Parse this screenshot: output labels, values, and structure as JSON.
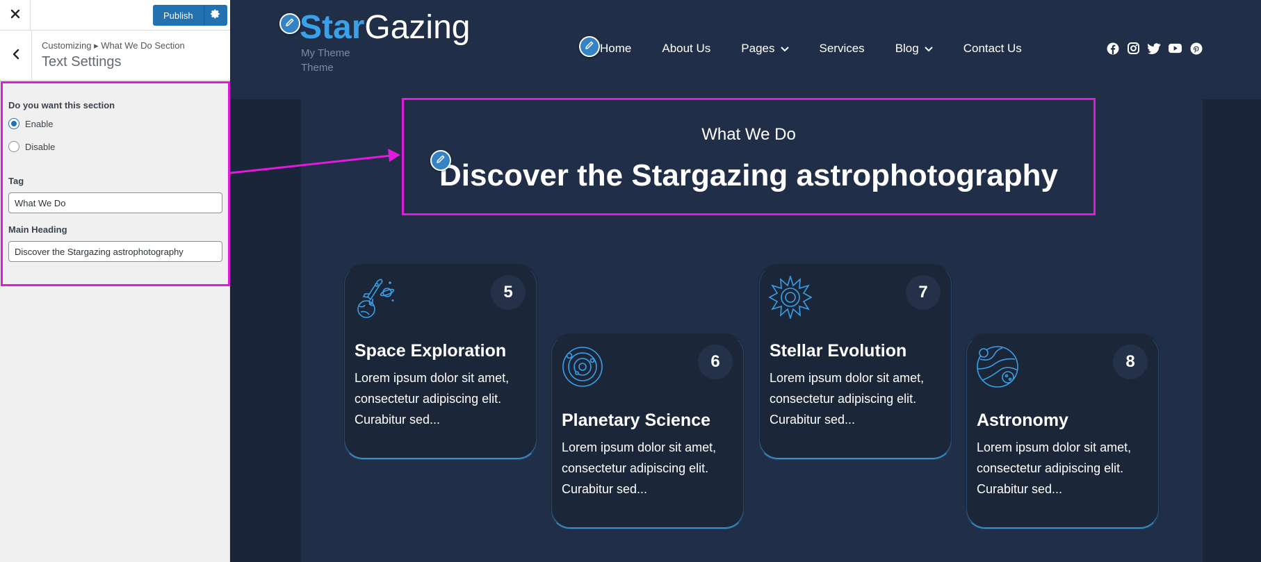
{
  "sidebar": {
    "close_icon": "close-icon",
    "publish_label": "Publish",
    "settings_icon": "gear-icon",
    "back_icon": "chevron-left-icon",
    "breadcrumb": "Customizing ▸ What We Do Section",
    "panel_title": "Text Settings",
    "section_toggle": {
      "label": "Do you want this section",
      "options": [
        "Enable",
        "Disable"
      ],
      "selected": "Enable"
    },
    "tag_field": {
      "label": "Tag",
      "value": "What We Do"
    },
    "heading_field": {
      "label": "Main Heading",
      "value": "Discover the Stargazing astrophotography"
    }
  },
  "site": {
    "logo_part1": "Star",
    "logo_part2": "Gazing",
    "tagline_line1": "My Theme",
    "tagline_line2": "Theme",
    "nav": [
      {
        "label": "Home",
        "dropdown": false
      },
      {
        "label": "About Us",
        "dropdown": false
      },
      {
        "label": "Pages",
        "dropdown": true
      },
      {
        "label": "Services",
        "dropdown": false
      },
      {
        "label": "Blog",
        "dropdown": true
      },
      {
        "label": "Contact Us",
        "dropdown": false
      }
    ],
    "social_icons": [
      "facebook-icon",
      "instagram-icon",
      "twitter-icon",
      "youtube-icon",
      "pinterest-icon"
    ]
  },
  "section": {
    "tag": "What We Do",
    "heading": "Discover the Stargazing astrophotography",
    "cards": [
      {
        "number": "5",
        "title": "Space Exploration",
        "text": "Lorem ipsum dolor sit amet, consectetur adipiscing elit. Curabitur sed...",
        "icon": "rocket-planet-icon"
      },
      {
        "number": "6",
        "title": "Planetary Science",
        "text": "Lorem ipsum dolor sit amet, consectetur adipiscing elit. Curabitur sed...",
        "icon": "orbit-icon"
      },
      {
        "number": "7",
        "title": "Stellar Evolution",
        "text": "Lorem ipsum dolor sit amet, consectetur adipiscing elit. Curabitur sed...",
        "icon": "sun-icon"
      },
      {
        "number": "8",
        "title": "Astronomy",
        "text": "Lorem ipsum dolor sit amet, consectetur adipiscing elit. Curabitur sed...",
        "icon": "planets-icon"
      }
    ]
  },
  "colors": {
    "accent": "#3aa0e8",
    "highlight": "#e21adc",
    "wp_blue": "#2271b1",
    "bg_dark": "#212e47"
  }
}
